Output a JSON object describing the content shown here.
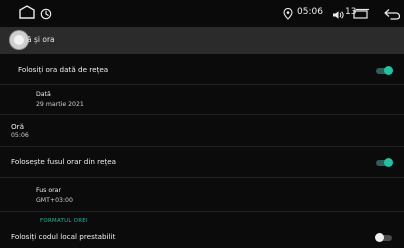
{
  "status": {
    "time": "05:06",
    "volume": "13"
  },
  "header": {
    "title": "ă și ora"
  },
  "settings": {
    "use_network_time_label": "Folosiți ora dată de rețea",
    "date_label": "Dată",
    "date_value": "29 martie 2021",
    "time_label": "Oră",
    "time_value": "05:06",
    "use_network_timezone_label": "Folosește fusul orar din rețea",
    "timezone_label": "Fus orar",
    "timezone_value": "GMT+03:00",
    "time_format_section": "FORMATUL OREI",
    "use_locale_default_label": "Folosiți codul local prestabilit"
  },
  "toggles": {
    "use_network_time": "on",
    "use_network_timezone": "on",
    "use_locale_default": "off"
  },
  "colors": {
    "accent": "#21c2a4",
    "background": "#0b0b0b",
    "header": "#2b2b2b"
  }
}
